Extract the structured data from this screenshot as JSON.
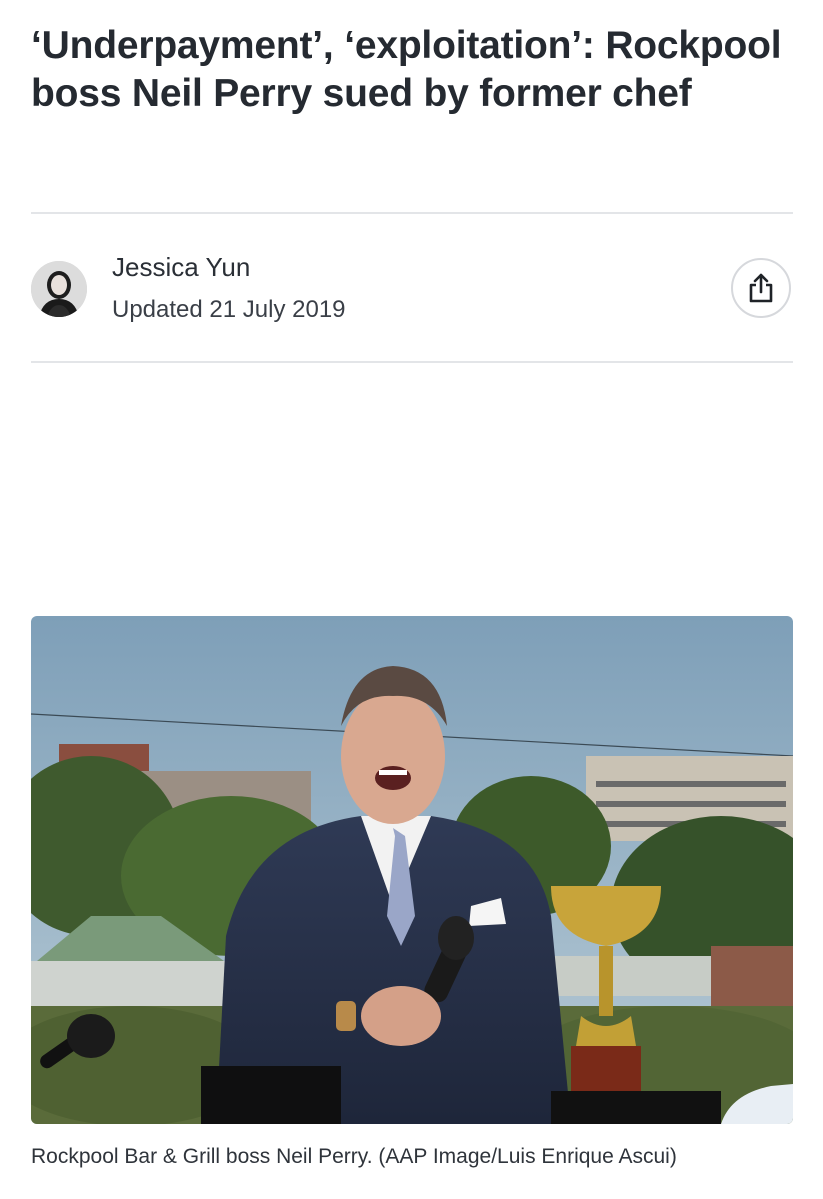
{
  "article": {
    "headline": "‘Underpayment’, ‘exploitation’: Rockpool boss Neil Perry sued by former chef",
    "author": "Jessica Yun",
    "updated": "Updated 21 July 2019"
  },
  "hero": {
    "caption": "Rockpool Bar & Grill boss Neil Perry. (AAP Image/Luis Enrique Ascui)"
  },
  "icons": {
    "share": "share-icon",
    "avatar": "author-avatar"
  }
}
